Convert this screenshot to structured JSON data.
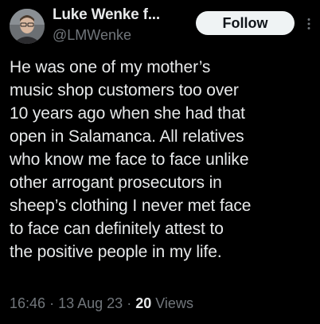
{
  "author": {
    "display_name": "Luke Wenke f...",
    "handle": "@LMWenke"
  },
  "actions": {
    "follow_label": "Follow",
    "more_icon": "more-vertical-icon"
  },
  "tweet": {
    "text": "He was one of my mother’s\nmusic shop customers too over\n10 years ago when she had that\nopen in Salamanca. All relatives\nwho know me face to face unlike\nother arrogant prosecutors in\nsheep’s clothing I never met face\nto face can definitely attest to\nthe positive people in my life.",
    "time": "16:46",
    "separator": "·",
    "date": "13 Aug 23",
    "views_count": "20",
    "views_label": "Views"
  },
  "colors": {
    "background": "#000000",
    "primary_text": "#e7e9ea",
    "secondary_text": "#71767b",
    "follow_button_bg": "#eff3f4"
  }
}
